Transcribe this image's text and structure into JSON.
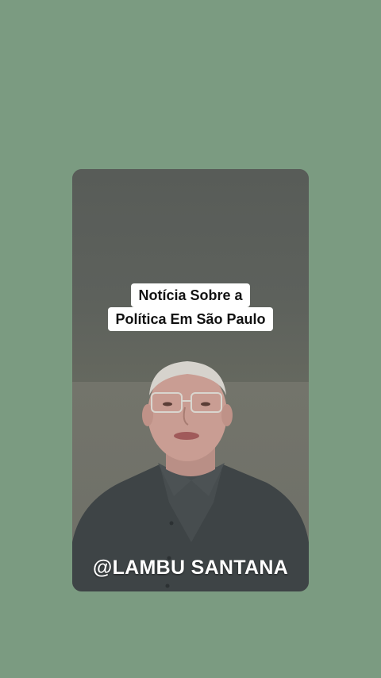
{
  "video": {
    "caption_line_1": "Notícia Sobre a",
    "caption_line_2": "Política Em São Paulo",
    "handle": "@LAMBU SANTANA"
  },
  "colors": {
    "background": "#7b9b81",
    "caption_box": "#ffffff",
    "caption_text": "#111111",
    "handle_text": "#ffffff"
  }
}
